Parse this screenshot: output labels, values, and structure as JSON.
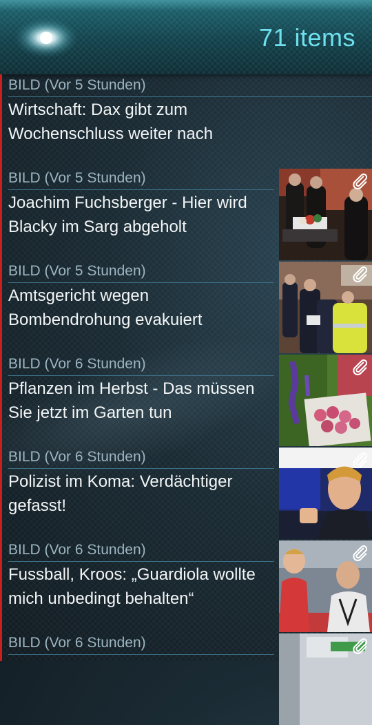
{
  "header": {
    "item_count": "71 items"
  },
  "articles": [
    {
      "source": "BILD (Vor 5 Stunden)",
      "title": "Wirtschaft: Dax gibt zum Wochenschluss weiter nach",
      "has_thumbnail": false
    },
    {
      "source": "BILD (Vor 5 Stunden)",
      "title": "Joachim Fuchsberger - Hier wird Blacky im Sarg abgeholt",
      "has_thumbnail": true,
      "thumbnail_icon": "attachment-icon"
    },
    {
      "source": "BILD (Vor 5 Stunden)",
      "title": "Amtsgericht wegen Bombendrohung evakuiert",
      "has_thumbnail": true,
      "thumbnail_icon": "attachment-icon"
    },
    {
      "source": "BILD (Vor 6 Stunden)",
      "title": "Pflanzen im Herbst - Das müssen Sie jetzt im Garten tun",
      "has_thumbnail": true,
      "thumbnail_icon": "attachment-icon"
    },
    {
      "source": "BILD (Vor 6 Stunden)",
      "title": "Polizist im Koma: Verdächtiger gefasst!",
      "has_thumbnail": true,
      "thumbnail_icon": "attachment-icon"
    },
    {
      "source": "BILD (Vor 6 Stunden)",
      "title": "Fussball, Kroos: „Guardiola wollte mich unbedingt behalten“",
      "has_thumbnail": true,
      "thumbnail_icon": "attachment-icon"
    },
    {
      "source": "BILD (Vor 6 Stunden)",
      "title": "",
      "has_thumbnail": true,
      "thumbnail_icon": "attachment-icon"
    }
  ],
  "colors": {
    "accent": "#6fe1ee",
    "unread_marker": "#c81f1f",
    "source_text": "#9db6c2",
    "title_text": "#f2f5f6"
  }
}
